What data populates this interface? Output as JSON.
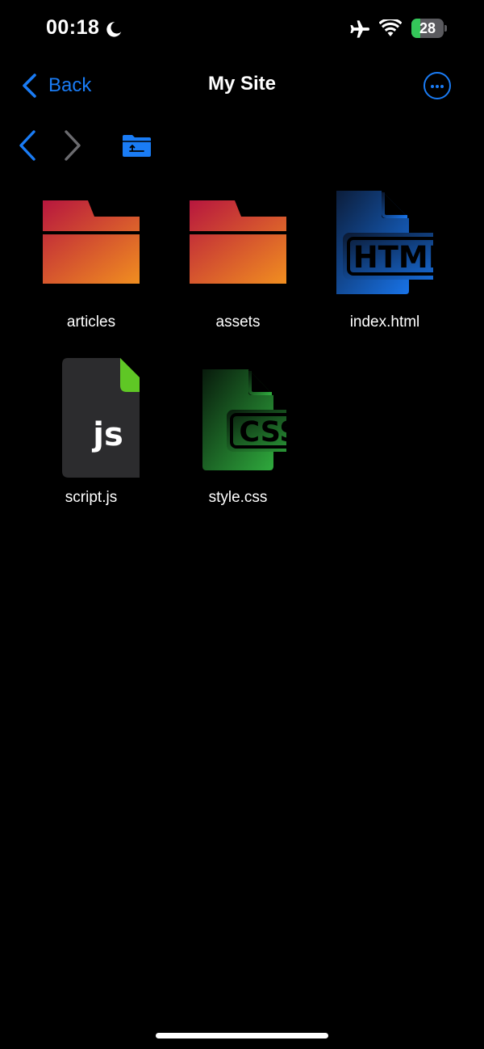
{
  "status_bar": {
    "time": "00:18",
    "battery_level": "28",
    "battery_fill_fraction": 0.28,
    "icons": [
      "moon-icon",
      "airplane-icon",
      "wifi-icon",
      "battery-icon"
    ]
  },
  "nav": {
    "back_label": "Back",
    "title": "My Site",
    "more_icon": "ellipsis-circle-icon"
  },
  "toolbar": {
    "icons": [
      "chevron-left-icon",
      "chevron-right-icon",
      "enclosing-folder-icon"
    ]
  },
  "files": [
    {
      "name": "articles",
      "kind": "folder"
    },
    {
      "name": "assets",
      "kind": "folder"
    },
    {
      "name": "index.html",
      "kind": "html"
    },
    {
      "name": "script.js",
      "kind": "js",
      "badge": "js"
    },
    {
      "name": "style.css",
      "kind": "css"
    }
  ],
  "colors": {
    "accent": "#1a7cf5",
    "folder_gradient": [
      "#b5123f",
      "#f4951e"
    ],
    "html_badge": "#1873e8",
    "js_corner": "#5fc725",
    "css_badge": "#2faa3d"
  }
}
